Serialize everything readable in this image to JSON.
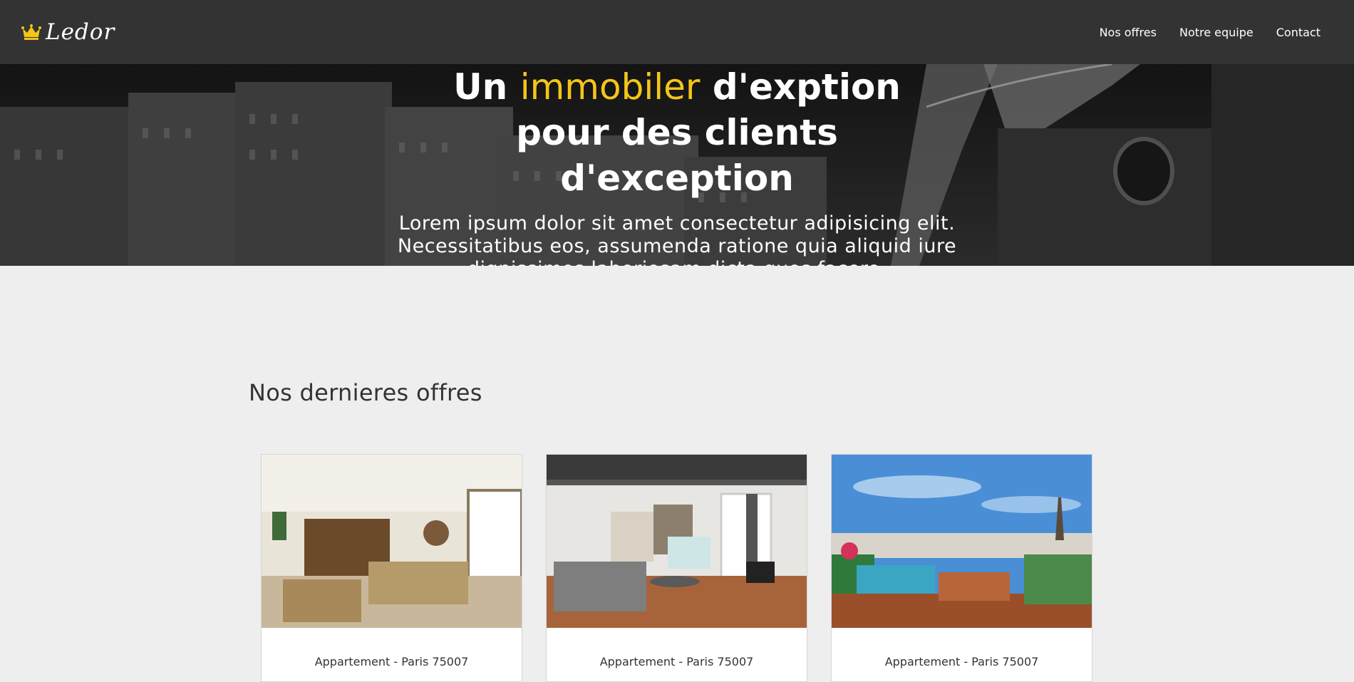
{
  "brand": {
    "name": "Ledor",
    "icon": "crown-icon",
    "accent_color": "#f5c518"
  },
  "nav": {
    "items": [
      {
        "label": "Nos offres"
      },
      {
        "label": "Notre equipe"
      },
      {
        "label": "Contact"
      }
    ]
  },
  "hero": {
    "title_prefix": "Un",
    "title_accent": "immobiler",
    "title_suffix": "d'exption pour des clients d'exception",
    "subtitle": "Lorem ipsum dolor sit amet consectetur adipisicing elit. Necessitatibus eos, assumenda ratione quia aliquid iure dignissimos laboriosam dicta quos facere."
  },
  "offers": {
    "title": "Nos dernieres offres",
    "cards": [
      {
        "caption": "Appartement - Paris 75007"
      },
      {
        "caption": "Appartement - Paris 75007"
      },
      {
        "caption": "Appartement - Paris 75007"
      }
    ]
  }
}
